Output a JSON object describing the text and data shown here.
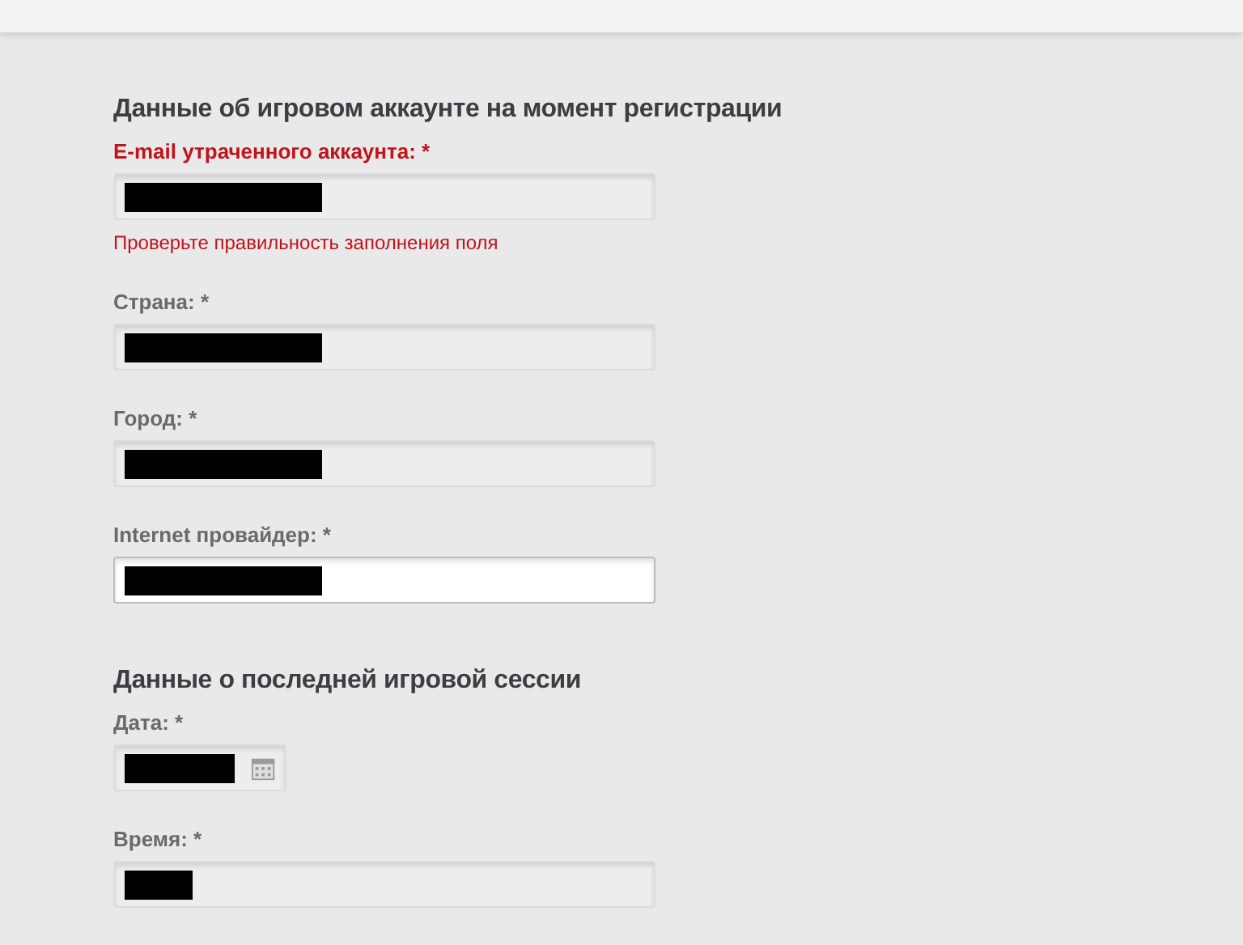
{
  "sections": [
    {
      "title": "Данные об игровом аккаунте на момент регистрации",
      "fields": [
        {
          "label": "E-mail утраченного аккаунта: *",
          "kind": "text",
          "invalid": true,
          "error_message": "Проверьте правильность заполнения поля",
          "focused": false,
          "redacted": true
        },
        {
          "label": "Страна: *",
          "kind": "text",
          "invalid": false,
          "focused": false,
          "redacted": true
        },
        {
          "label": "Город: *",
          "kind": "text",
          "invalid": false,
          "focused": false,
          "redacted": true
        },
        {
          "label": "Internet провайдер: *",
          "kind": "text",
          "invalid": false,
          "focused": true,
          "redacted": true
        }
      ]
    },
    {
      "title": "Данные о последней игровой сессии",
      "fields": [
        {
          "label": "Дата: *",
          "kind": "date",
          "invalid": false,
          "focused": false,
          "redacted": true
        },
        {
          "label": "Время: *",
          "kind": "time",
          "invalid": false,
          "focused": false,
          "redacted": true
        }
      ]
    }
  ]
}
